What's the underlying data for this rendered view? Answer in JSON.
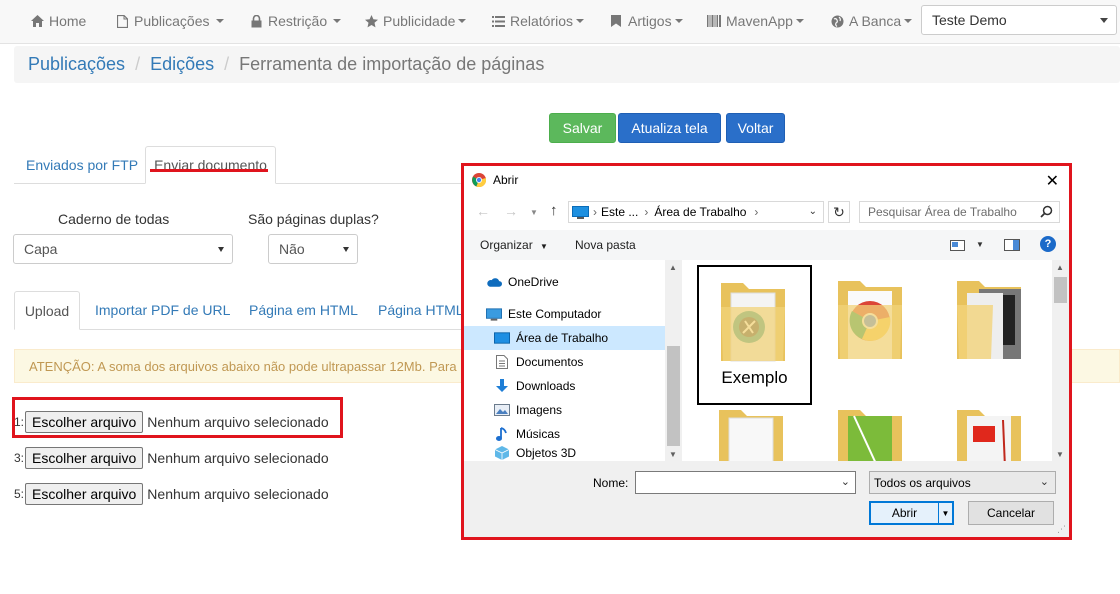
{
  "navbar": {
    "items": [
      {
        "label": "Home",
        "icon": "home-icon"
      },
      {
        "label": "Publicações",
        "icon": "file-icon"
      },
      {
        "label": "Restrição",
        "icon": "lock-icon"
      },
      {
        "label": "Publicidade",
        "icon": "star-icon"
      },
      {
        "label": "Relatórios",
        "icon": "list-icon"
      },
      {
        "label": "Artigos",
        "icon": "bookmark-icon"
      },
      {
        "label": "MavenApp",
        "icon": "barcode-icon"
      },
      {
        "label": "A Banca",
        "icon": "globe-icon"
      }
    ],
    "user_select": "Teste Demo"
  },
  "breadcrumb": {
    "items": [
      "Publicações",
      "Edições"
    ],
    "active": "Ferramenta de importação de páginas"
  },
  "actions": {
    "save": "Salvar",
    "refresh": "Atualiza tela",
    "back": "Voltar"
  },
  "tabs": {
    "ftp": "Enviados por FTP",
    "upload_doc": "Enviar documento"
  },
  "form": {
    "caderno_label": "Caderno de todas",
    "caderno_value": "Capa",
    "duplas_label": "São páginas duplas?",
    "duplas_value": "Não"
  },
  "subtabs": {
    "upload": "Upload",
    "import_pdf": "Importar PDF de URL",
    "html_page": "Página em HTML",
    "html_page2": "Página HTML"
  },
  "alert": "ATENÇÃO: A soma dos arquivos abaixo não pode ultrapassar 12Mb. Para",
  "file_rows": [
    {
      "num": "1:",
      "button": "Escolher arquivo",
      "status": "Nenhum arquivo selecionado"
    },
    {
      "num": "3:",
      "button": "Escolher arquivo",
      "status": "Nenhum arquivo selecionado"
    },
    {
      "num": "5:",
      "button": "Escolher arquivo",
      "status": "Nenhum arquivo selecionado"
    }
  ],
  "dialog": {
    "title": "Abrir",
    "path": [
      "Este ...",
      "Área de Trabalho"
    ],
    "search_placeholder": "Pesquisar Área de Trabalho",
    "organize": "Organizar",
    "new_folder": "Nova pasta",
    "nav": [
      {
        "label": "OneDrive",
        "icon": "cloud-icon"
      },
      {
        "label": "Este Computador",
        "icon": "computer-icon"
      },
      {
        "label": "Área de Trabalho",
        "icon": "desktop-icon"
      },
      {
        "label": "Documentos",
        "icon": "document-icon"
      },
      {
        "label": "Downloads",
        "icon": "download-icon"
      },
      {
        "label": "Imagens",
        "icon": "image-icon"
      },
      {
        "label": "Músicas",
        "icon": "music-icon"
      },
      {
        "label": "Objetos 3D",
        "icon": "cube-icon"
      }
    ],
    "selected_folder": "Exemplo",
    "name_label": "Nome:",
    "name_value": "",
    "file_type": "Todos os arquivos",
    "open": "Abrir",
    "cancel": "Cancelar"
  },
  "colors": {
    "highlight_red": "#e0141d",
    "link_blue": "#337ab7",
    "save_green": "#5cb85c",
    "action_blue": "#2a6fc9"
  }
}
